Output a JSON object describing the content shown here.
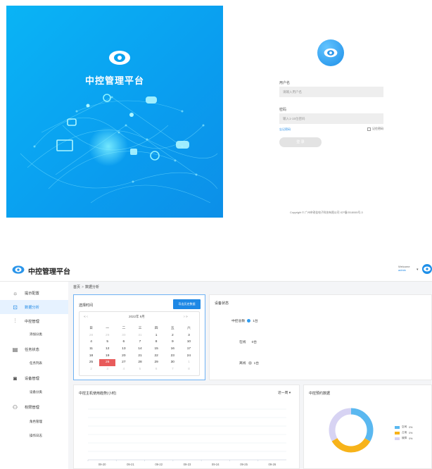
{
  "login": {
    "app_title": "中控管理平台",
    "username_label": "用户名",
    "username_placeholder": "请输入用户名",
    "password_label": "密码",
    "password_placeholder": "输入1-15位密码",
    "forgot_label": "忘记密码",
    "remember_label": "记住密码",
    "login_button": "登 录",
    "copyright": "Copyright © 广州市锐佳电子科技有限公司 ICP备2018065号-3"
  },
  "header": {
    "title": "中控管理平台",
    "welcome": "Welcome",
    "user": "admin",
    "caret": "▾"
  },
  "sidebar": {
    "items": [
      {
        "label": "提示配置",
        "icon": "bulb-icon",
        "glyph": "☼"
      },
      {
        "label": "数据分析",
        "icon": "chart-icon",
        "glyph": "⊡"
      },
      {
        "label": "中控管理",
        "icon": "sliders-icon",
        "glyph": "⫶"
      },
      {
        "label": "任务状态",
        "icon": "list-icon",
        "glyph": "▤"
      },
      {
        "label": "设备管理",
        "icon": "device-icon",
        "glyph": "◙"
      },
      {
        "label": "权限管理",
        "icon": "user-icon",
        "glyph": "⚇"
      }
    ],
    "subitems": [
      "添加分类",
      "任务列表",
      "设备分类",
      "角色管理",
      "操作日志"
    ]
  },
  "breadcrumb": {
    "home": "首页",
    "sep": ">",
    "current": "数据分析"
  },
  "date_card": {
    "title": "选择时间",
    "export_button": "导出历史数据",
    "nav_prev": "«  ‹",
    "month_label": "2022年 9月",
    "nav_next": "›  »",
    "weekdays": [
      "日",
      "一",
      "二",
      "三",
      "四",
      "五",
      "六"
    ],
    "weeks": [
      [
        "28",
        "29",
        "30",
        "31",
        "1",
        "2",
        "3"
      ],
      [
        "4",
        "5",
        "6",
        "7",
        "8",
        "9",
        "10"
      ],
      [
        "11",
        "12",
        "13",
        "14",
        "15",
        "16",
        "17"
      ],
      [
        "18",
        "19",
        "20",
        "21",
        "22",
        "23",
        "24"
      ],
      [
        "25",
        "26",
        "27",
        "28",
        "29",
        "30",
        "1"
      ],
      [
        "2",
        "3",
        "4",
        "5",
        "6",
        "7",
        "8"
      ]
    ],
    "selected_day": "26"
  },
  "status_card": {
    "title": "设备状态",
    "items": [
      {
        "label": "中控总数",
        "value": "1台",
        "color": "#2f9cf0"
      },
      {
        "label": "在线",
        "value": "0台",
        "color": ""
      },
      {
        "label": "离线",
        "value": "1台",
        "color": "#bdbdbd"
      }
    ]
  },
  "usage_card": {
    "title": "中控主机使用趋势(小时)",
    "range": "近一周 ▾"
  },
  "chart_data": [
    {
      "type": "line",
      "title": "中控主机使用趋势(小时)",
      "x": [
        "09-20",
        "09-21",
        "09-22",
        "09-23",
        "09-24",
        "09-25",
        "09-26"
      ],
      "series": [],
      "grid": true
    },
    {
      "type": "pie",
      "title": "中控预约数据",
      "series": [
        {
          "name": "空闲",
          "value": 0,
          "display": "0%",
          "color": "#5ab8f0"
        },
        {
          "name": "占用",
          "value": 0,
          "display": "0%",
          "color": "#f7b31a"
        },
        {
          "name": "故障",
          "value": 0,
          "display": "0%",
          "color": "#d7d3f3"
        }
      ],
      "legend": "right"
    }
  ],
  "colors": {
    "primary": "#1e88e5",
    "hero": "#0a9ff0",
    "today": "#e85b5b"
  }
}
